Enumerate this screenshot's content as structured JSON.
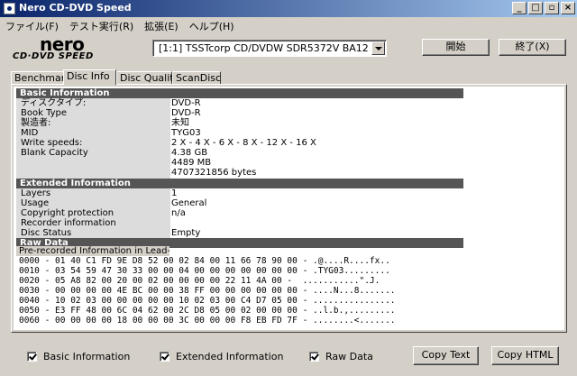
{
  "window": {
    "title": "Nero CD-DVD Speed",
    "restore_glyph": "▫",
    "minimize_glyph": "_",
    "maximize_glyph": "□",
    "close_glyph": "×"
  },
  "menu": [
    {
      "label": "ファイル(F)"
    },
    {
      "label": "テスト実行(R)"
    },
    {
      "label": "拡張(E)"
    },
    {
      "label": "ヘルプ(H)"
    }
  ],
  "logo": {
    "main": "nero",
    "sub": "CD·DVD SPEED"
  },
  "drive": {
    "selected": "[1:1]   TSSTcorp CD/DVDW SDR5372V BA12"
  },
  "buttons": {
    "start": "開始",
    "end": "終了(X)",
    "copy_text": "Copy Text",
    "copy_html": "Copy HTML"
  },
  "tabs": [
    {
      "label": "Benchmark"
    },
    {
      "label": "Disc Info"
    },
    {
      "label": "Disc Quality"
    },
    {
      "label": "ScanDisc"
    }
  ],
  "basic": {
    "header": "Basic Information",
    "rows": [
      {
        "label": "ディスクタイプ:",
        "value": "DVD-R"
      },
      {
        "label": "Book Type",
        "value": "DVD-R"
      },
      {
        "label": "製造者:",
        "value": " 未知"
      },
      {
        "label": "MID",
        "value": "TYG03"
      },
      {
        "label": "Write speeds:",
        "value": "2 X - 4 X - 6 X - 8 X - 12 X - 16 X"
      },
      {
        "label": "Blank Capacity",
        "value": "4.38 GB"
      },
      {
        "label": "",
        "value": "4489 MB"
      },
      {
        "label": "",
        "value": "4707321856 bytes"
      }
    ]
  },
  "extended": {
    "header": "Extended Information",
    "rows": [
      {
        "label": "Layers",
        "value": "1"
      },
      {
        "label": "Usage",
        "value": "General"
      },
      {
        "label": "Copyright protection",
        "value": "n/a"
      },
      {
        "label": "Recorder information",
        "value": ""
      },
      {
        "label": "Disc Status",
        "value": "Empty"
      }
    ]
  },
  "raw": {
    "header": "Raw Data",
    "label": "Pre-recorded Information in Lead-in ...",
    "lines": [
      "0000 - 01 40 C1 FD 9E D8 52 00 02 84 00 11 66 78 90 00 - .@....R....fx..",
      "0010 - 03 54 59 47 30 33 00 00 04 00 00 00 00 00 00 00 - .TYG03.........",
      "0020 - 05 A8 82 00 20 00 02 00 00 00 00 22 11 4A 00 -  ...........\".J.",
      "0030 - 00 00 00 00 4E BC 00 00 38 FF 00 00 00 00 00 00 - ....N...8.......",
      "0040 - 10 02 03 00 00 00 00 00 10 02 03 00 C4 D7 05 00 - ................",
      "0050 - E3 FF 48 00 6C 04 62 00 2C D8 05 00 02 00 00 00 - ..l.b.,.........",
      "0060 - 00 00 00 00 18 00 00 00 3C 00 00 00 F8 EB FD 7F - ........<......."
    ]
  },
  "checkboxes": [
    {
      "label": "Basic Information",
      "checked": true
    },
    {
      "label": "Extended Information",
      "checked": true
    },
    {
      "label": "Raw Data",
      "checked": true
    }
  ],
  "colors": {
    "titlebar_start": "#0a246a",
    "titlebar_end": "#a6caf0",
    "section_header": "#555555",
    "label_column": "#dcdcdc"
  }
}
